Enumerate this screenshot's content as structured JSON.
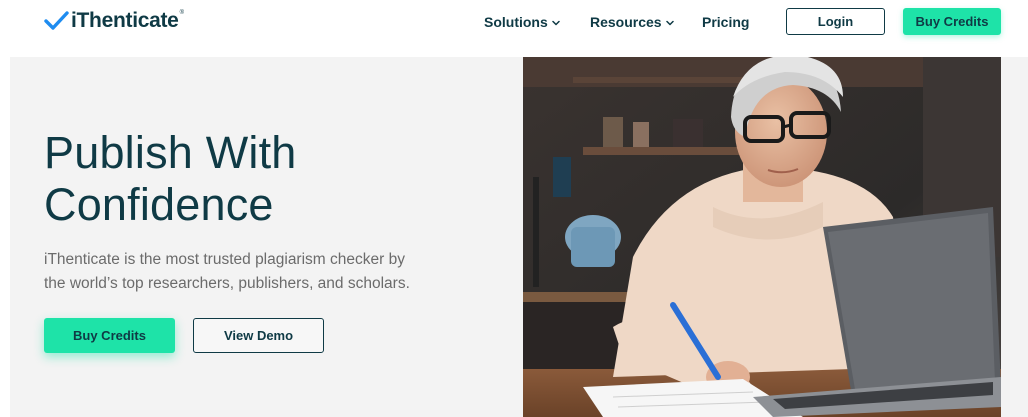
{
  "header": {
    "logo_text": "iThenticate",
    "logo_tm": "®",
    "nav": {
      "solutions": "Solutions",
      "resources": "Resources",
      "pricing": "Pricing"
    },
    "login_label": "Login",
    "buy_credits_label": "Buy Credits"
  },
  "hero": {
    "title_line1": "Publish With",
    "title_line2": "Confidence",
    "subtitle_line1": "iThenticate is the most trusted plagiarism checker by",
    "subtitle_line2": "the world’s top researchers, publishers, and scholars.",
    "buy_credits_label": "Buy Credits",
    "view_demo_label": "View Demo"
  },
  "colors": {
    "brand_dark": "#0f3a45",
    "accent_green": "#1ee3a8",
    "logo_blue": "#1e8cf0",
    "hero_bg": "#f3f3f3"
  },
  "icons": {
    "logo": "checkmark-icon",
    "nav_dropdown": "chevron-down-icon"
  }
}
